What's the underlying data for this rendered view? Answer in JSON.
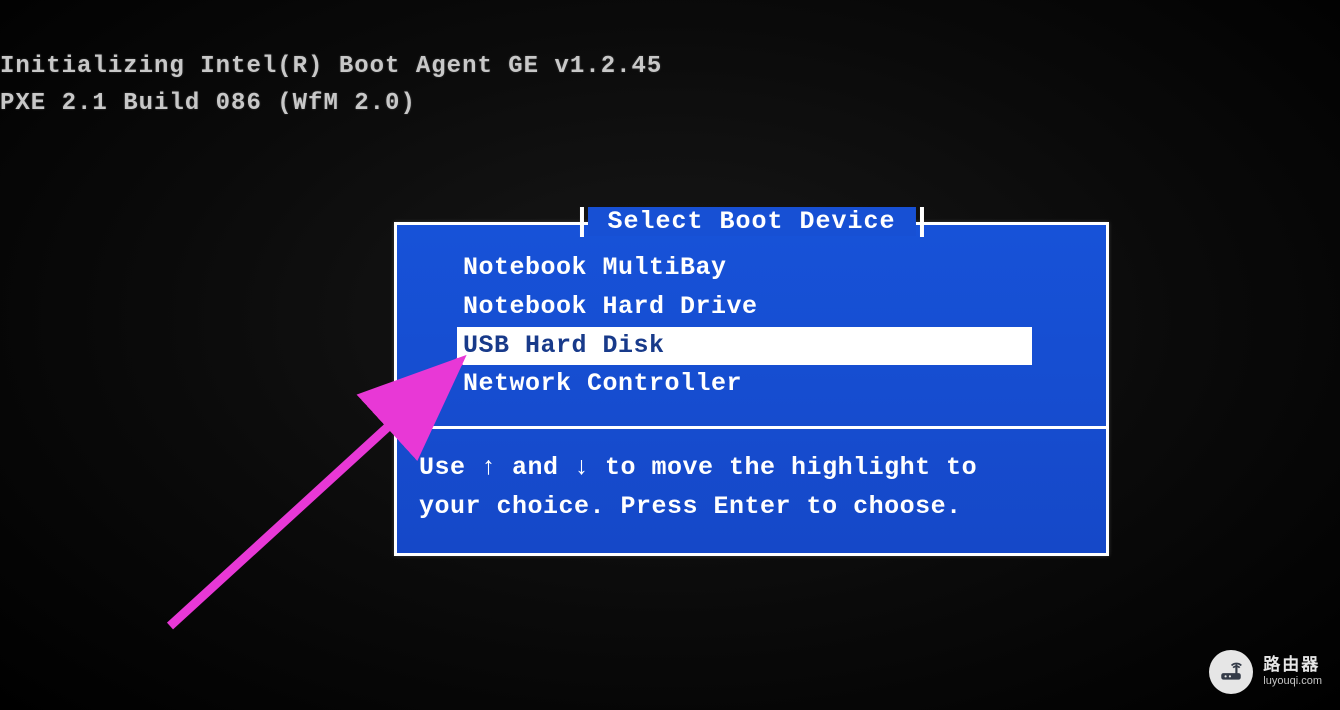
{
  "boot": {
    "line1": "Initializing Intel(R) Boot Agent GE v1.2.45",
    "line2": "PXE 2.1 Build 086 (WfM 2.0)"
  },
  "dialog": {
    "title": "Select Boot Device",
    "devices": [
      {
        "label": "Notebook MultiBay",
        "selected": false
      },
      {
        "label": "Notebook Hard Drive",
        "selected": false
      },
      {
        "label": "USB Hard Disk",
        "selected": true
      },
      {
        "label": "Network Controller",
        "selected": false
      }
    ],
    "help": "Use ↑ and ↓ to move the highlight to\nyour choice.  Press Enter to choose."
  },
  "watermark": {
    "zh": "路由器",
    "en": "luyouqi.com"
  },
  "colors": {
    "dialog_bg": "#1a4fd0",
    "highlight_bg": "#ffffff",
    "highlight_fg": "#183a8a",
    "arrow": "#e838d6"
  }
}
